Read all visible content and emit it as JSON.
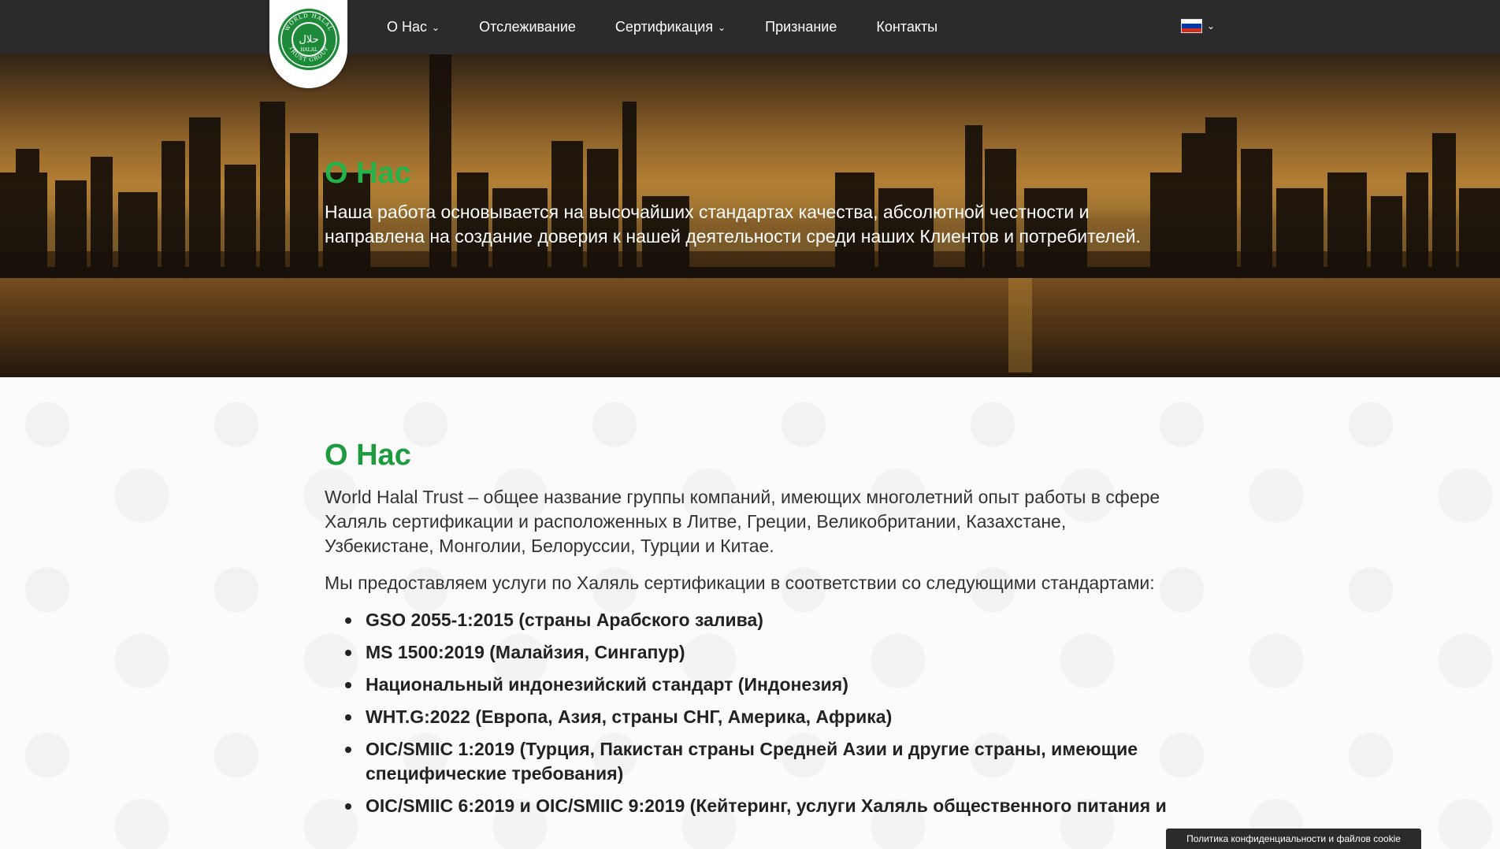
{
  "header": {
    "logo": {
      "alt": "World Halal Trust Group",
      "ring_text_top": "WORLD HALAL",
      "ring_text_bottom": "TRUST GROUP",
      "center_arabic": "حلال",
      "center_latin": "HALAL"
    },
    "nav": [
      {
        "label": "О Нас",
        "has_dropdown": true
      },
      {
        "label": "Отслеживание",
        "has_dropdown": false
      },
      {
        "label": "Сертификация",
        "has_dropdown": true
      },
      {
        "label": "Признание",
        "has_dropdown": false
      },
      {
        "label": "Контакты",
        "has_dropdown": false
      }
    ],
    "language": {
      "flag": "russia-flag",
      "colors": [
        "#ffffff",
        "#0039a6",
        "#d52b1e"
      ]
    }
  },
  "hero": {
    "title": "О Нас",
    "text": "Наша работа основывается на высочайших стандартах качества, абсолютной честности и направлена на создание доверия к нашей деятельности среди наших Клиентов и потребителей."
  },
  "about": {
    "title": "О Нас",
    "paragraph1": "World Halal Trust – общее название группы компаний, имеющих многолетний опыт работы в сфере Халяль сертификации и расположенных в Литве, Греции, Великобритании, Казахстане, Узбекистане, Монголии, Белоруссии, Турции и Китае.",
    "paragraph2": "Мы предоставляем услуги по Халяль сертификации в соответствии со следующими стандартами:",
    "standards": [
      "GSO 2055-1:2015 (страны Арабского залива)",
      "MS 1500:2019 (Малайзия, Сингапур)",
      "Национальный индонезийский стандарт (Индонезия)",
      "WHT.G:2022 (Европа, Азия, страны СНГ, Америка, Африка)",
      "OIC/SMIIC 1:2019 (Турция, Пакистан страны Средней Азии и другие страны, имеющие специфические требования)",
      "OIC/SMIIC 6:2019 и OIC/SMIIC 9:2019 (Кейтеринг, услуги Халяль общественного питания и"
    ]
  },
  "cookie_bar": {
    "label": "Политика конфиденциальности и файлов cookie"
  },
  "colors": {
    "accent_green": "#24b24b",
    "header_bg": "#2b2b2b"
  }
}
